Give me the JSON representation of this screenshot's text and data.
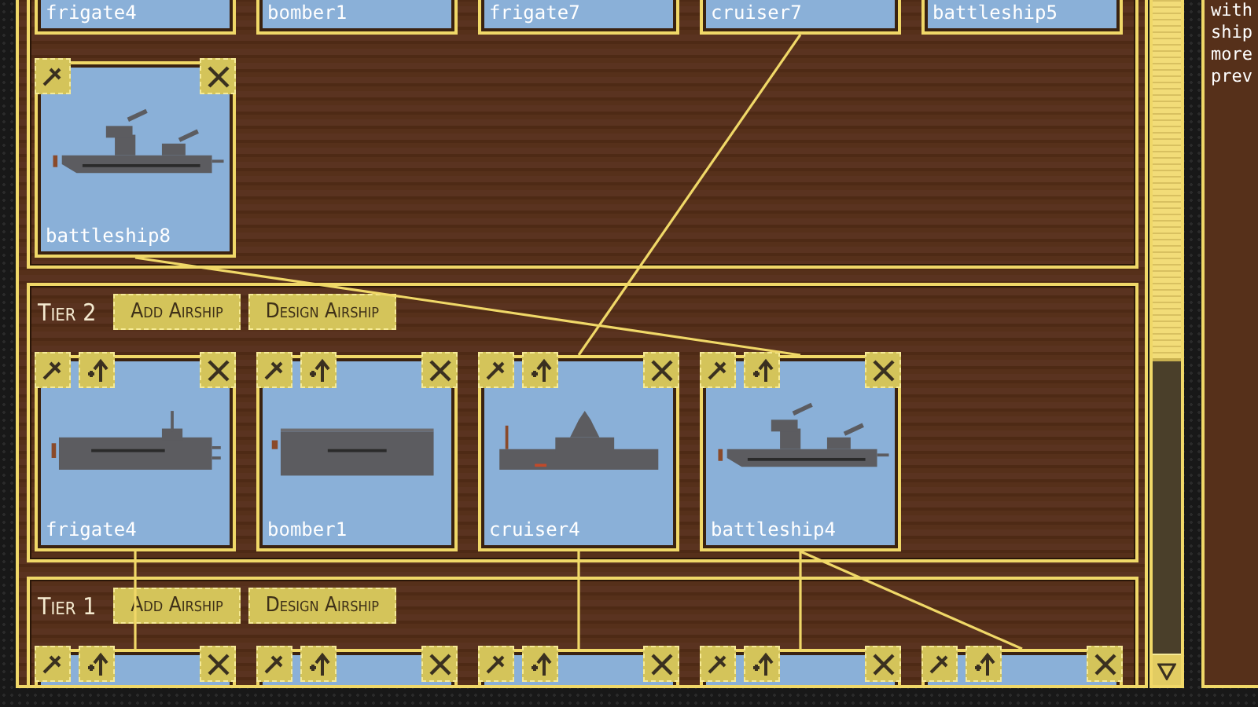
{
  "tiers": [
    {
      "cards": [
        {
          "name": "frigate4"
        },
        {
          "name": "bomber1"
        },
        {
          "name": "frigate7"
        },
        {
          "name": "cruiser7"
        },
        {
          "name": "battleship5"
        },
        {
          "name": "battleship8",
          "kind": "battleship",
          "edit": true,
          "upgrade": false,
          "remove": true
        }
      ]
    },
    {
      "label": "Tier 2",
      "buttons": [
        "Add Airship",
        "Design Airship"
      ],
      "cards": [
        {
          "name": "frigate4",
          "kind": "frigate",
          "edit": true,
          "upgrade": true,
          "remove": true
        },
        {
          "name": "bomber1",
          "kind": "bomber",
          "edit": true,
          "upgrade": true,
          "remove": true
        },
        {
          "name": "cruiser4",
          "kind": "cruiser",
          "edit": true,
          "upgrade": true,
          "remove": true
        },
        {
          "name": "battleship4",
          "kind": "battleship",
          "edit": true,
          "upgrade": true,
          "remove": true
        }
      ]
    },
    {
      "label": "Tier 1",
      "buttons": [
        "Add Airship",
        "Design Airship"
      ],
      "cards": [
        {
          "edit": true,
          "upgrade": true,
          "remove": true
        },
        {
          "edit": true,
          "upgrade": true,
          "remove": true
        },
        {
          "edit": true,
          "upgrade": true,
          "remove": true
        },
        {
          "edit": true,
          "upgrade": true,
          "remove": true
        },
        {
          "edit": true,
          "upgrade": true,
          "remove": true
        }
      ]
    }
  ],
  "side_panel": {
    "text": "with ship more prev"
  }
}
